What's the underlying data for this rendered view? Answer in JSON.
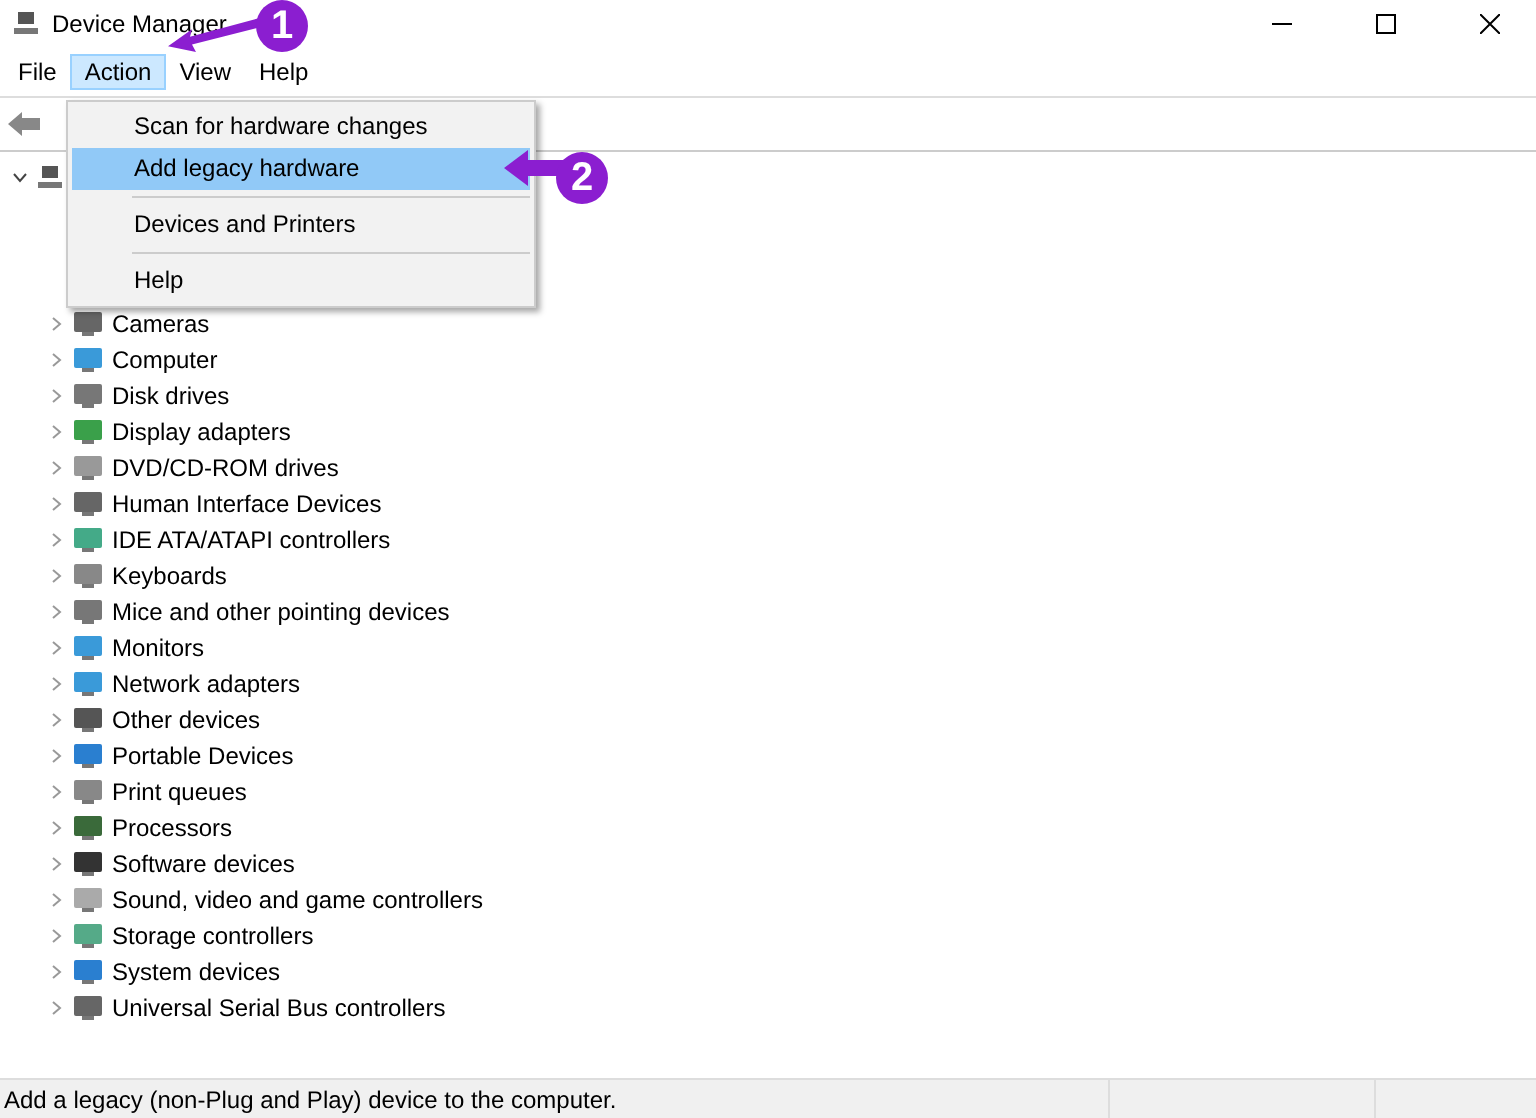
{
  "window": {
    "title": "Device Manager"
  },
  "menu_bar": [
    {
      "label": "File",
      "selected": false
    },
    {
      "label": "Action",
      "selected": true
    },
    {
      "label": "View",
      "selected": false
    },
    {
      "label": "Help",
      "selected": false
    }
  ],
  "action_menu": [
    {
      "kind": "item",
      "label": "Scan for hardware changes",
      "selected": false
    },
    {
      "kind": "item",
      "label": "Add legacy hardware",
      "selected": true
    },
    {
      "kind": "separator"
    },
    {
      "kind": "item",
      "label": "Devices and Printers",
      "selected": false
    },
    {
      "kind": "separator"
    },
    {
      "kind": "item",
      "label": "Help",
      "selected": false
    }
  ],
  "tree": {
    "expanded": true,
    "children": [
      {
        "label": "Cameras",
        "expanded": false
      },
      {
        "label": "Computer",
        "expanded": false
      },
      {
        "label": "Disk drives",
        "expanded": false
      },
      {
        "label": "Display adapters",
        "expanded": false
      },
      {
        "label": "DVD/CD-ROM drives",
        "expanded": false
      },
      {
        "label": "Human Interface Devices",
        "expanded": false
      },
      {
        "label": "IDE ATA/ATAPI controllers",
        "expanded": false
      },
      {
        "label": "Keyboards",
        "expanded": false
      },
      {
        "label": "Mice and other pointing devices",
        "expanded": false
      },
      {
        "label": "Monitors",
        "expanded": false
      },
      {
        "label": "Network adapters",
        "expanded": false
      },
      {
        "label": "Other devices",
        "expanded": false
      },
      {
        "label": "Portable Devices",
        "expanded": false
      },
      {
        "label": "Print queues",
        "expanded": false
      },
      {
        "label": "Processors",
        "expanded": false
      },
      {
        "label": "Software devices",
        "expanded": false
      },
      {
        "label": "Sound, video and game controllers",
        "expanded": false
      },
      {
        "label": "Storage controllers",
        "expanded": false
      },
      {
        "label": "System devices",
        "expanded": false
      },
      {
        "label": "Universal Serial Bus controllers",
        "expanded": false
      }
    ]
  },
  "annotations": [
    {
      "label": "1"
    },
    {
      "label": "2"
    }
  ],
  "status_bar": {
    "text": "Add a legacy (non-Plug and Play) device to the computer."
  }
}
